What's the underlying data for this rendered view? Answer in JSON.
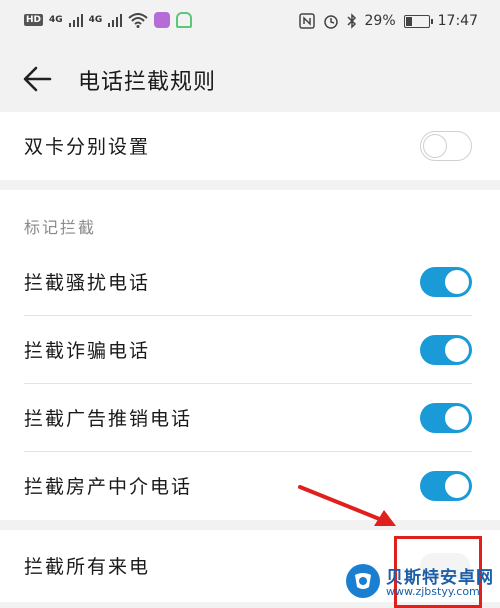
{
  "status_bar": {
    "hd": "HD",
    "net1": "4G",
    "net2": "4G",
    "battery": "29%",
    "time": "17:47",
    "battery_level": 0.29
  },
  "header": {
    "title": "电话拦截规则"
  },
  "rows": {
    "dual_sim": {
      "label": "双卡分别设置",
      "toggle": "off"
    },
    "harass": {
      "label": "拦截骚扰电话",
      "toggle": "on"
    },
    "fraud": {
      "label": "拦截诈骗电话",
      "toggle": "on"
    },
    "ads": {
      "label": "拦截广告推销电话",
      "toggle": "on"
    },
    "agent": {
      "label": "拦截房产中介电话",
      "toggle": "on"
    },
    "all": {
      "label": "拦截所有来电",
      "toggle": "off"
    }
  },
  "section": {
    "mark_block": "标记拦截"
  },
  "watermark": {
    "title": "贝斯特安卓网",
    "url": "www.zjbstyy.com"
  },
  "colors": {
    "accent": "#1a9bd7",
    "annotation": "#e0201d"
  }
}
